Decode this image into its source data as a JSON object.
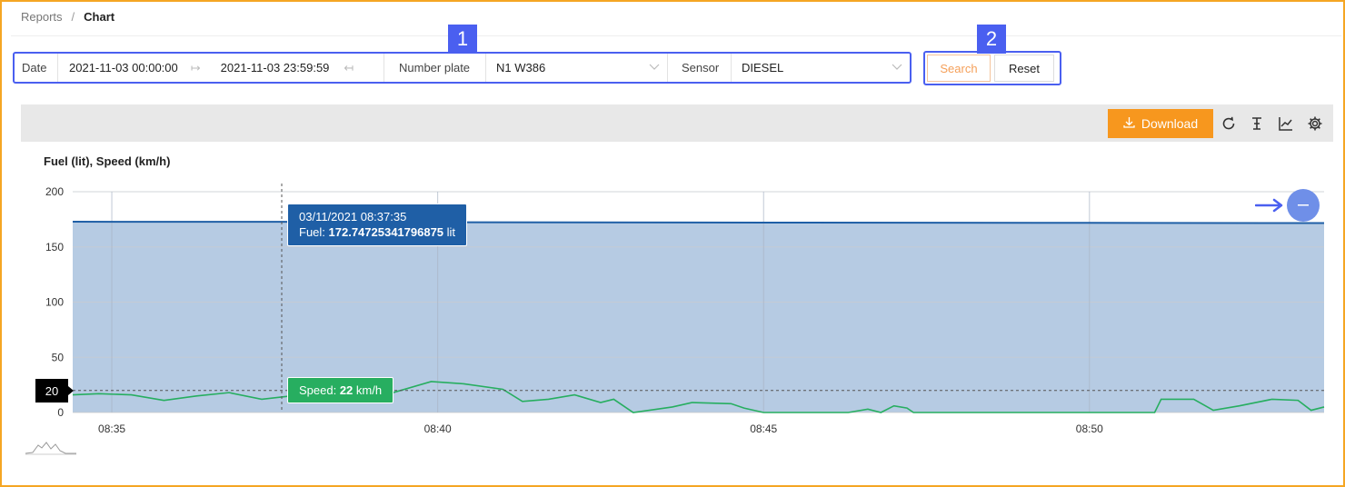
{
  "breadcrumb": {
    "root": "Reports",
    "separator": "/",
    "current": "Chart"
  },
  "filters": {
    "date_label": "Date",
    "date_from": "2021-11-03 00:00:00",
    "date_to": "2021-11-03 23:59:59",
    "plate_label": "Number plate",
    "plate_value": "N1 W386",
    "sensor_label": "Sensor",
    "sensor_value": "DIESEL"
  },
  "badges": {
    "filters": "1",
    "actions": "2"
  },
  "actions": {
    "search": "Search",
    "reset": "Reset"
  },
  "toolbar": {
    "download": "Download",
    "icons": [
      "download-icon",
      "refresh-icon",
      "text-cursor-icon",
      "line-chart-icon",
      "gear-icon"
    ]
  },
  "colors": {
    "accent": "#f7971e",
    "annotation": "#4a5ff0",
    "fuel": "#1f5fa6",
    "fuel_fill": "#b6cbe3",
    "speed": "#27ae60"
  },
  "tooltip": {
    "fuel_time": "03/11/2021 08:37:35",
    "fuel_prefix": "Fuel: ",
    "fuel_value": "172.74725341796875",
    "fuel_unit": " lit",
    "speed_prefix": "Speed: ",
    "speed_value": "22",
    "speed_unit": " km/h"
  },
  "y_marker": "20",
  "chart_data": {
    "type": "area",
    "title": "Fuel (lit), Speed (km/h)",
    "ylim": [
      0,
      200
    ],
    "yticks": [
      "0",
      "50",
      "100",
      "150",
      "200"
    ],
    "xticks": [
      "08:35",
      "08:40",
      "08:45",
      "08:50"
    ],
    "xrange_minutes": [
      34.4,
      53.6
    ],
    "grid": true,
    "series": [
      {
        "name": "Fuel",
        "unit": "lit",
        "points": [
          [
            34.4,
            172.8
          ],
          [
            37.6,
            172.7
          ],
          [
            40.0,
            172.4
          ],
          [
            45.0,
            172.0
          ],
          [
            50.0,
            171.8
          ],
          [
            53.6,
            171.6
          ]
        ]
      },
      {
        "name": "Speed",
        "unit": "km/h",
        "points": [
          [
            34.4,
            16
          ],
          [
            34.8,
            17
          ],
          [
            35.3,
            16
          ],
          [
            35.8,
            11
          ],
          [
            36.3,
            15
          ],
          [
            36.8,
            18
          ],
          [
            37.3,
            12
          ],
          [
            37.9,
            16
          ],
          [
            38.6,
            22
          ],
          [
            39.2,
            16
          ],
          [
            39.9,
            28
          ],
          [
            40.4,
            26
          ],
          [
            41.0,
            21
          ],
          [
            41.3,
            10
          ],
          [
            41.7,
            12
          ],
          [
            42.1,
            16
          ],
          [
            42.5,
            9
          ],
          [
            42.7,
            12
          ],
          [
            43.0,
            0
          ],
          [
            43.6,
            5
          ],
          [
            43.9,
            9
          ],
          [
            44.5,
            8
          ],
          [
            44.7,
            4
          ],
          [
            45.0,
            0
          ],
          [
            45.6,
            0
          ],
          [
            46.3,
            0
          ],
          [
            46.6,
            3
          ],
          [
            46.8,
            0
          ],
          [
            47.0,
            6
          ],
          [
            47.2,
            4
          ],
          [
            47.3,
            0
          ],
          [
            48.0,
            0
          ],
          [
            50.0,
            0
          ],
          [
            51.0,
            0
          ],
          [
            51.1,
            12
          ],
          [
            51.6,
            12
          ],
          [
            51.9,
            2
          ],
          [
            52.3,
            6
          ],
          [
            52.8,
            12
          ],
          [
            53.2,
            11
          ],
          [
            53.4,
            2
          ],
          [
            53.6,
            5
          ]
        ]
      }
    ]
  }
}
